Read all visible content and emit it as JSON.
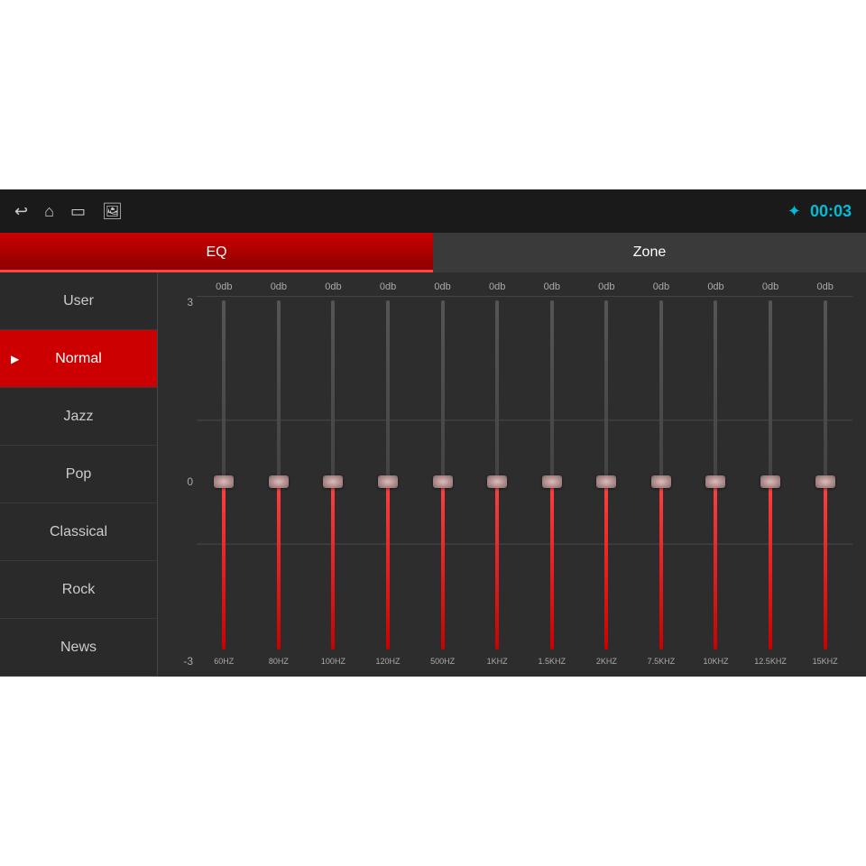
{
  "screen": {
    "top_bar": {
      "time": "00:03",
      "icons": [
        "back",
        "home",
        "screen",
        "image"
      ]
    },
    "tabs": [
      {
        "label": "EQ",
        "active": true
      },
      {
        "label": "Zone",
        "active": false
      }
    ],
    "sidebar": {
      "items": [
        {
          "label": "User",
          "active": false,
          "playing": false
        },
        {
          "label": "Normal",
          "active": true,
          "playing": true
        },
        {
          "label": "Jazz",
          "active": false,
          "playing": false
        },
        {
          "label": "Pop",
          "active": false,
          "playing": false
        },
        {
          "label": "Classical",
          "active": false,
          "playing": false
        },
        {
          "label": "Rock",
          "active": false,
          "playing": false
        },
        {
          "label": "News",
          "active": false,
          "playing": false
        }
      ]
    },
    "eq": {
      "scale": {
        "top": "3",
        "mid": "0",
        "bottom": "-3"
      },
      "bands": [
        {
          "freq": "60HZ",
          "db": "0db",
          "value": 0
        },
        {
          "freq": "80HZ",
          "db": "0db",
          "value": 0
        },
        {
          "freq": "100HZ",
          "db": "0db",
          "value": 0
        },
        {
          "freq": "120HZ",
          "db": "0db",
          "value": 0
        },
        {
          "freq": "500HZ",
          "db": "0db",
          "value": 0
        },
        {
          "freq": "1KHZ",
          "db": "0db",
          "value": 0
        },
        {
          "freq": "1.5KHZ",
          "db": "0db",
          "value": 0
        },
        {
          "freq": "2KHZ",
          "db": "0db",
          "value": 0
        },
        {
          "freq": "7.5KHZ",
          "db": "0db",
          "value": 0
        },
        {
          "freq": "10KHZ",
          "db": "0db",
          "value": 0
        },
        {
          "freq": "12.5KHZ",
          "db": "0db",
          "value": 0
        },
        {
          "freq": "15KHZ",
          "db": "0db",
          "value": 0
        }
      ]
    }
  }
}
